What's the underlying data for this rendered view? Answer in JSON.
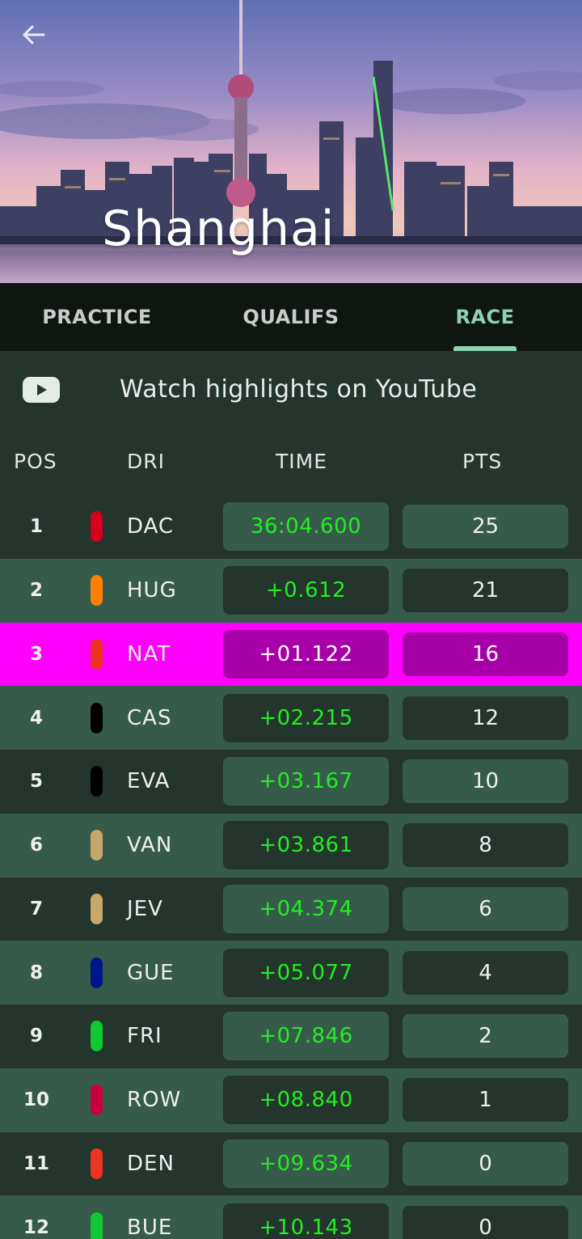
{
  "header": {
    "city": "Shanghai"
  },
  "tabs": [
    {
      "label": "PRACTICE",
      "active": false
    },
    {
      "label": "QUALIFS",
      "active": false
    },
    {
      "label": "RACE",
      "active": true
    }
  ],
  "highlights": {
    "label": "Watch highlights on YouTube",
    "icon": "youtube-icon"
  },
  "columns": {
    "pos": "POS",
    "driver": "DRI",
    "time": "TIME",
    "points": "PTS"
  },
  "results": [
    {
      "pos": "1",
      "driver": "DAC",
      "team_color": "#d4001e",
      "time": "36:04.600",
      "pts": "25"
    },
    {
      "pos": "2",
      "driver": "HUG",
      "team_color": "#ff8000",
      "time": "+0.612",
      "pts": "21"
    },
    {
      "pos": "3",
      "driver": "NAT",
      "team_color": "#ee3524",
      "time": "+01.122",
      "pts": "16",
      "highlight": true
    },
    {
      "pos": "4",
      "driver": "CAS",
      "team_color": "#000000",
      "time": "+02.215",
      "pts": "12"
    },
    {
      "pos": "5",
      "driver": "EVA",
      "team_color": "#000000",
      "time": "+03.167",
      "pts": "10"
    },
    {
      "pos": "6",
      "driver": "VAN",
      "team_color": "#c8a86a",
      "time": "+03.861",
      "pts": "8"
    },
    {
      "pos": "7",
      "driver": "JEV",
      "team_color": "#c8a86a",
      "time": "+04.374",
      "pts": "6"
    },
    {
      "pos": "8",
      "driver": "GUE",
      "team_color": "#00148c",
      "time": "+05.077",
      "pts": "4"
    },
    {
      "pos": "9",
      "driver": "FRI",
      "team_color": "#10c830",
      "time": "+07.846",
      "pts": "2"
    },
    {
      "pos": "10",
      "driver": "ROW",
      "team_color": "#c8003c",
      "time": "+08.840",
      "pts": "1"
    },
    {
      "pos": "11",
      "driver": "DEN",
      "team_color": "#ee3524",
      "time": "+09.634",
      "pts": "0"
    },
    {
      "pos": "12",
      "driver": "BUE",
      "team_color": "#10c830",
      "time": "+10.143",
      "pts": "0"
    }
  ],
  "colors": {
    "accent": "#8fd2b1",
    "time_green": "#22ee22",
    "highlight": "#ff00ff",
    "highlight_box": "#a800a8",
    "row_dark": "#24352d",
    "row_light": "#375b4b"
  }
}
